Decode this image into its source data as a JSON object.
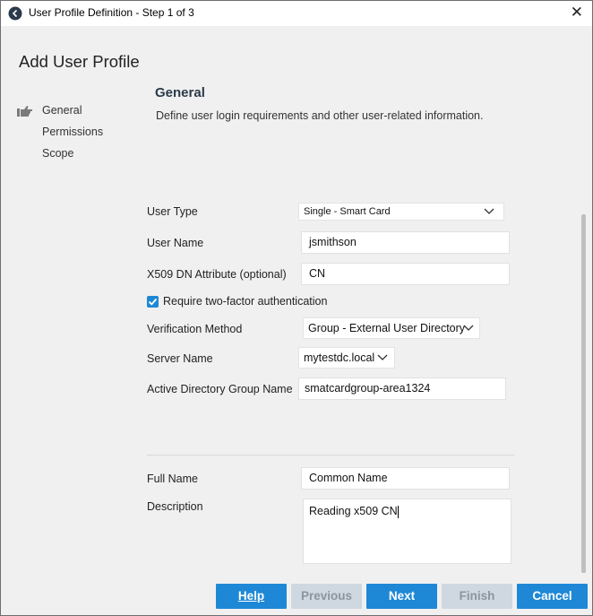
{
  "window": {
    "title": "User Profile Definition - Step 1 of 3"
  },
  "page": {
    "title": "Add User Profile"
  },
  "nav": {
    "items": [
      {
        "label": "General"
      },
      {
        "label": "Permissions"
      },
      {
        "label": "Scope"
      }
    ]
  },
  "section": {
    "title": "General",
    "description": "Define user login requirements and other user-related information."
  },
  "form": {
    "user_type_label": "User Type",
    "user_type_value": "Single - Smart Card",
    "user_name_label": "User Name",
    "user_name_value": "jsmithson",
    "x509_label": "X509 DN Attribute (optional)",
    "x509_value": "CN",
    "two_factor_label": "Require two-factor authentication",
    "two_factor_checked": true,
    "verification_label": "Verification Method",
    "verification_value": "Group - External User Directory",
    "server_label": "Server Name",
    "server_value": "mytestdc.local",
    "ad_group_label": "Active Directory Group Name",
    "ad_group_value": "smatcardgroup-area1324",
    "full_name_label": "Full Name",
    "full_name_value": "Common Name",
    "description_label": "Description",
    "description_value": "Reading x509 CN"
  },
  "buttons": {
    "help": "Help",
    "previous": "Previous",
    "next": "Next",
    "finish": "Finish",
    "cancel": "Cancel"
  },
  "colors": {
    "accent": "#1e88d6",
    "disabled": "#cfd8e0"
  },
  "icons": [
    "app-icon",
    "close-icon",
    "pointing-hand-icon",
    "chevron-down-icon",
    "checkmark-icon"
  ]
}
